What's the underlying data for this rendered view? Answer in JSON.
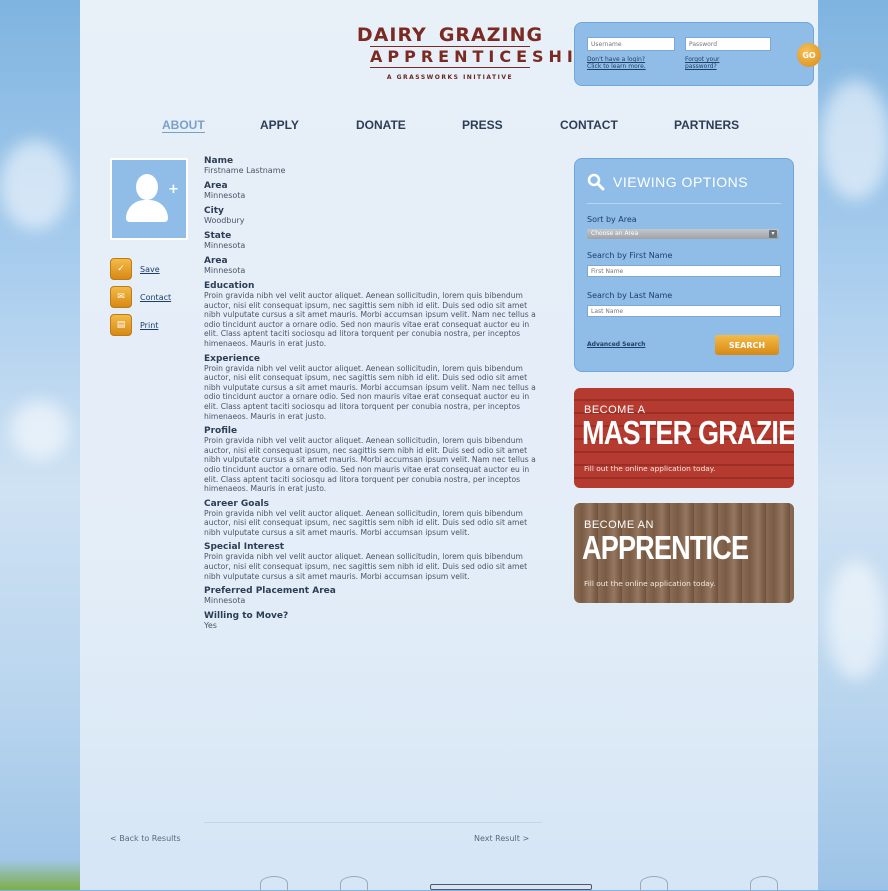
{
  "logo": {
    "line1_left": "DAIRY",
    "line1_right": "GRAZING",
    "line2": "APPRENTICESHIP",
    "tagline": "A GRASSWORKS INITIATIVE"
  },
  "login": {
    "username_placeholder": "Username",
    "password_placeholder": "Password",
    "no_login_text": "Don't have a login?",
    "no_login_link": "Click to learn more.",
    "forgot_line1": "Forgot your",
    "forgot_line2": "password?",
    "go_label": "GO"
  },
  "nav": {
    "items": [
      "ABOUT",
      "APPLY",
      "DONATE",
      "PRESS",
      "CONTACT",
      "PARTNERS"
    ]
  },
  "actions": {
    "save": "Save",
    "contact": "Contact",
    "print": "Print"
  },
  "profile": {
    "name_label": "Name",
    "name_value": "Firstname Lastname",
    "area_label": "Area",
    "area_value": "Minnesota",
    "city_label": "City",
    "city_value": "Woodbury",
    "state_label": "State",
    "state_value": "Minnesota",
    "area2_label": "Area",
    "area2_value": "Minnesota",
    "education_label": "Education",
    "education_text": "Proin gravida nibh vel velit auctor aliquet. Aenean sollicitudin, lorem quis bibendum auctor, nisi elit consequat ipsum, nec sagittis sem nibh id elit. Duis sed odio sit amet nibh vulputate cursus a sit amet mauris. Morbi accumsan ipsum velit. Nam nec tellus a odio tincidunt auctor a ornare odio. Sed non mauris vitae erat consequat auctor eu in elit. Class aptent taciti sociosqu ad litora torquent per conubia nostra, per inceptos himenaeos. Mauris in erat justo.",
    "experience_label": "Experience",
    "experience_text": "Proin gravida nibh vel velit auctor aliquet. Aenean sollicitudin, lorem quis bibendum auctor, nisi elit consequat ipsum, nec sagittis sem nibh id elit. Duis sed odio sit amet nibh vulputate cursus a sit amet mauris. Morbi accumsan ipsum velit. Nam nec tellus a odio tincidunt auctor a ornare odio. Sed non mauris vitae erat consequat auctor eu in elit. Class aptent taciti sociosqu ad litora torquent per conubia nostra, per inceptos himenaeos. Mauris in erat justo.",
    "profile_label": "Profile",
    "profile_text": "Proin gravida nibh vel velit auctor aliquet. Aenean sollicitudin, lorem quis bibendum auctor, nisi elit consequat ipsum, nec sagittis sem nibh id elit. Duis sed odio sit amet nibh vulputate cursus a sit amet mauris. Morbi accumsan ipsum velit. Nam nec tellus a odio tincidunt auctor a ornare odio. Sed non mauris vitae erat consequat auctor eu in elit. Class aptent taciti sociosqu ad litora torquent per conubia nostra, per inceptos himenaeos. Mauris in erat justo.",
    "goals_label": "Career Goals",
    "goals_text": "Proin gravida nibh vel velit auctor aliquet. Aenean sollicitudin, lorem quis bibendum auctor, nisi elit consequat ipsum, nec sagittis sem nibh id elit. Duis sed odio sit amet nibh vulputate cursus a sit amet mauris. Morbi accumsan ipsum velit.",
    "interest_label": "Special Interest",
    "interest_text": "Proin gravida nibh vel velit auctor aliquet. Aenean sollicitudin, lorem quis bibendum auctor, nisi elit consequat ipsum, nec sagittis sem nibh id elit. Duis sed odio sit amet nibh vulputate cursus a sit amet mauris. Morbi accumsan ipsum velit.",
    "placement_label": "Preferred Placement Area",
    "placement_value": "Minnesota",
    "move_label": "Willing to Move?",
    "move_value": "Yes"
  },
  "pager": {
    "back": "< Back to Results",
    "next": "Next Result >"
  },
  "viewing_options": {
    "title": "VIEWING OPTIONS",
    "sort_label": "Sort by Area",
    "sort_selected": "Choose an Area",
    "first_label": "Search by First Name",
    "first_placeholder": "First Name",
    "last_label": "Search by Last Name",
    "last_placeholder": "Last Name",
    "advanced": "Advanced Search",
    "search_button": "SEARCH"
  },
  "banners": {
    "grazier_small": "BECOME A",
    "grazier_big": "MASTER GRAZIER",
    "grazier_caption": "Fill out the online application today.",
    "apprentice_small": "BECOME AN",
    "apprentice_big": "APPRENTICE",
    "apprentice_caption": "Fill out the online application today."
  },
  "colors": {
    "brand": "#7b2a22",
    "panel": "#8fbde8",
    "accent": "#e39a22",
    "nav_active": "#7aa0c8"
  }
}
